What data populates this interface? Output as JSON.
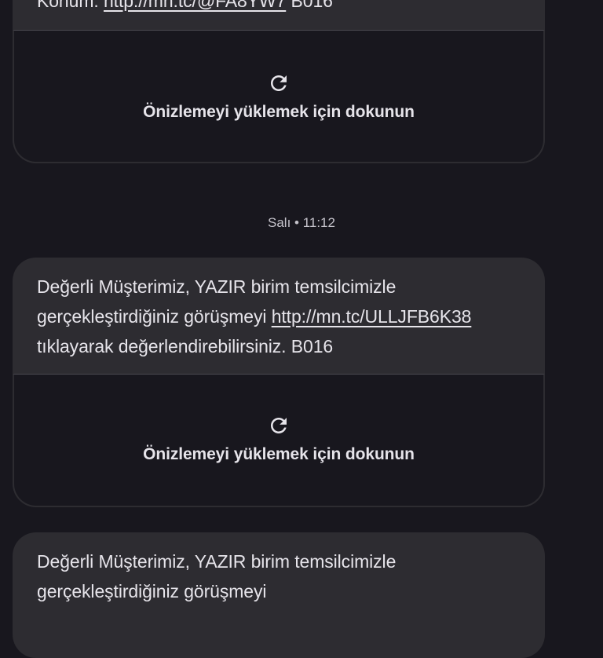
{
  "messages": [
    {
      "text_prefix": "Konum: ",
      "link": "http://mn.tc/@FA8YW7",
      "text_suffix": " B016",
      "preview_label": "Önizlemeyi yüklemek için dokunun",
      "preview_icon": "reload-icon"
    },
    {
      "text_line1": "Değerli Müşterimiz, YAZIR birim temsilcimizle",
      "text_line2_prefix": "gerçekleştirdiğiniz görüşmeyi ",
      "link": "http://mn.tc/ULLJFB6K38",
      "text_line3": "tıklayarak değerlendirebilirsiniz. B016",
      "preview_label": "Önizlemeyi yüklemek için dokunun",
      "preview_icon": "reload-icon"
    },
    {
      "text_line1": "Değerli Müşterimiz, YAZIR birim temsilcimizle",
      "text_line2": "gerçekleştirdiğiniz görüşmeyi"
    }
  ],
  "timestamp": "Salı • 11:12",
  "colors": {
    "background": "#18171e",
    "bubble": "#2d2c31",
    "text": "#e6e4ea"
  }
}
